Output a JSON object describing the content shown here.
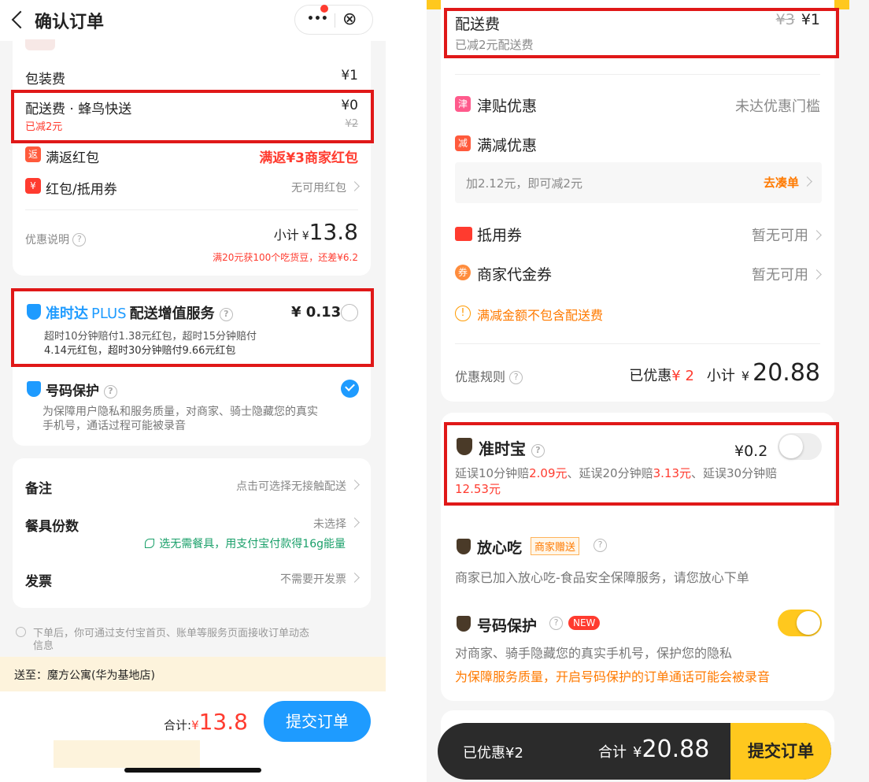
{
  "left": {
    "header": {
      "title": "确认订单",
      "more": "•••",
      "close": "⊗"
    },
    "packing": {
      "label": "包装费",
      "value": "¥1"
    },
    "delivery": {
      "label": "配送费 · 蜂鸟快送",
      "value": "¥0",
      "discount": "已减2元",
      "original": "¥2"
    },
    "fanhuan": {
      "badge": "返",
      "label": "满返红包",
      "value": "满返¥3商家红包"
    },
    "coupon": {
      "badge": "¥",
      "label": "红包/抵用券",
      "value": "无可用红包"
    },
    "summary": {
      "label": "优惠说明",
      "subtotal_label": "小计",
      "currency": "¥",
      "subtotal": "13.8",
      "note": "满20元获100个吃货豆，还差¥6.2"
    },
    "plus": {
      "brand": "准时达",
      "plus": "PLUS",
      "title": "配送增值服务",
      "price": "¥ 0.13",
      "desc1": "超时10分钟赔付1.38元红包，超时15分钟赔付",
      "desc2": "4.14元红包，超时30分钟赔付9.66元红包"
    },
    "phone": {
      "title": "号码保护",
      "desc1": "为保障用户隐私和服务质量，对商家、骑士隐藏您的真实",
      "desc2": "手机号，通话过程可能被录音"
    },
    "remark": {
      "label": "备注",
      "value": "点击可选择无接触配送"
    },
    "tableware": {
      "label": "餐具份数",
      "value": "未选择",
      "note": "选无需餐具，用支付宝付款得16g能量"
    },
    "invoice": {
      "label": "发票",
      "value": "不需要开发票"
    },
    "info": "下单后，你可通过支付宝首页、账单等服务页面接收订单动态",
    "info2": "信息",
    "address": "送至：魔方公寓(华为基地店)",
    "total_label": "合计:",
    "total_currency": "¥",
    "total": "13.8",
    "submit": "提交订单"
  },
  "right": {
    "delivery": {
      "label": "配送费",
      "original": "¥3",
      "value": "¥1",
      "discount": "已减2元配送费"
    },
    "jintie": {
      "badge": "津",
      "label": "津贴优惠",
      "value": "未达优惠门槛"
    },
    "manjian": {
      "badge": "减",
      "label": "满减优惠",
      "hint": "加2.12元，即可减2元",
      "action": "去凑单"
    },
    "voucher": {
      "label": "抵用券",
      "value": "暂无可用"
    },
    "merchant_voucher": {
      "badge": "券",
      "label": "商家代金券",
      "value": "暂无可用"
    },
    "warning": "满减金额不包含配送费",
    "rules": {
      "label": "优惠规则",
      "saved_label": "已优惠",
      "saved": "¥ 2",
      "subtotal_label": "小计",
      "currency": "¥",
      "subtotal": "20.88"
    },
    "zhunshibao": {
      "title": "准时宝",
      "price": "¥0.2",
      "d1": "延误10分钟赔",
      "v1": "2.09元",
      "d2": "、延误20分钟赔",
      "v2": "3.13元",
      "d3": "、延误30分钟赔",
      "v3": "12.53元"
    },
    "fangxin": {
      "title": "放心吃",
      "tag": "商家赠送",
      "desc": "商家已加入放心吃-食品安全保障服务，请您放心下单"
    },
    "phone": {
      "title": "号码保护",
      "badge": "NEW",
      "desc": "对商家、骑手隐藏您的真实手机号，保护您的隐私",
      "warn": "为保障服务质量，开启号码保护的订单通话可能会被录音"
    },
    "bottom": {
      "saved": "已优惠¥2",
      "total_label": "合计",
      "currency": "¥",
      "total": "20.88",
      "submit": "提交订单"
    }
  },
  "colors": {
    "red": "#ff3b2f",
    "orange": "#ff7a00",
    "blue": "#1e9bff",
    "yellow": "#ffc81e",
    "dark": "#2b2b2b"
  }
}
